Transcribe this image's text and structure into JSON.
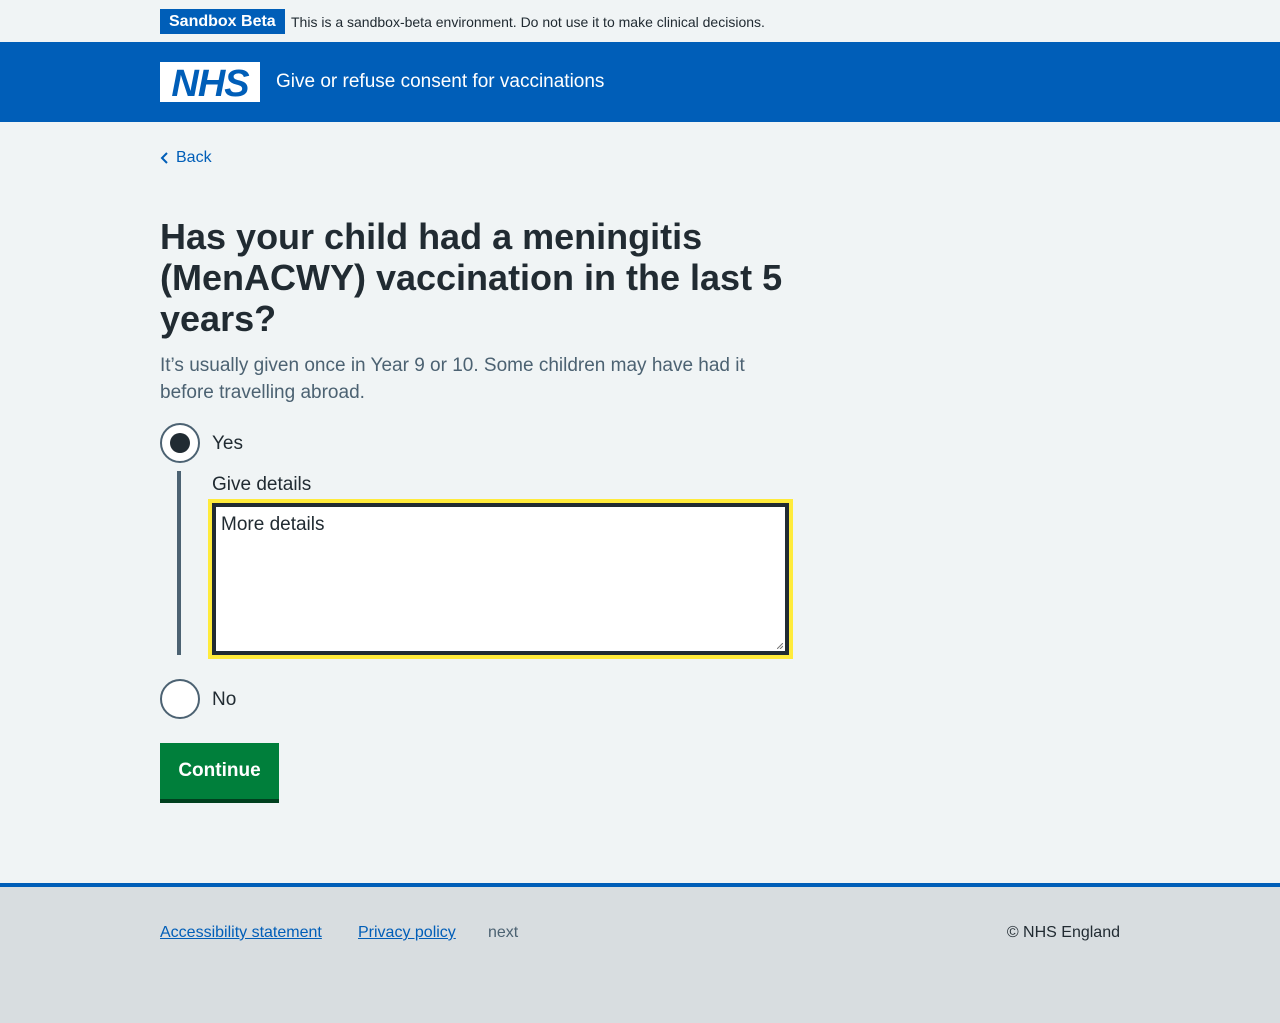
{
  "env_banner": {
    "tag": "Sandbox Beta",
    "text": "This is a sandbox-beta environment. Do not use it to make clinical decisions."
  },
  "header": {
    "logo_text": "NHS",
    "service_name": "Give or refuse consent for vaccinations"
  },
  "nav": {
    "back_label": "Back"
  },
  "question": {
    "heading": "Has your child had a meningitis (MenACWY) vaccination in the last 5 years?",
    "hint": "It’s usually given once in Year 9 or 10. Some children may have had it before travelling abroad."
  },
  "options": [
    {
      "label": "Yes",
      "selected": true
    },
    {
      "label": "No",
      "selected": false
    }
  ],
  "details": {
    "label": "Give details",
    "value": "More details"
  },
  "actions": {
    "continue_label": "Continue"
  },
  "footer": {
    "accessibility_label": "Accessibility statement",
    "privacy_label": "Privacy policy",
    "next_label": "next",
    "copyright": "© NHS England"
  },
  "colors": {
    "nhs_blue": "#005eb8",
    "button_green": "#007f3b",
    "focus_yellow": "#ffeb3b",
    "text": "#212b32",
    "secondary_text": "#4c6272",
    "page_bg": "#f0f4f5",
    "footer_bg": "#d8dde0"
  }
}
